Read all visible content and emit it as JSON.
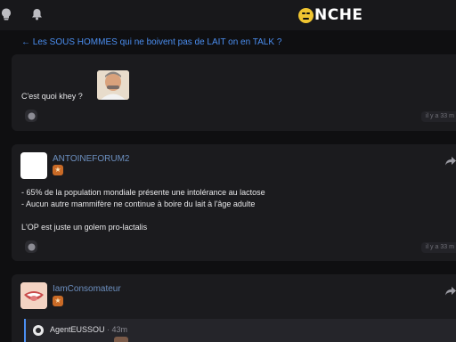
{
  "topbar": {
    "left_icons": [
      "lightbulb-icon",
      "bell-icon"
    ],
    "logo_text": "NCHE"
  },
  "breadcrumb": {
    "arrow": "←",
    "title": "Les SOUS HOMMES qui ne boivent pas de LAIT on en TALK ?"
  },
  "posts": [
    {
      "text": "C'est quoi khey ?",
      "time": "il y a 33 m"
    },
    {
      "author": "ANTOINEFORUM2",
      "lines": [
        "- 65% de la population mondiale présente une intolérance au lactose",
        "- Aucun autre mammifère ne continue à boire du lait à l'âge adulte",
        "L'OP est juste un golem pro-lactalis"
      ],
      "time": "il y a 33 m"
    },
    {
      "author": "IamConsomateur",
      "quote": {
        "author": "AgentEUSSOU",
        "time": "· 43m"
      }
    }
  ],
  "colors": {
    "background": "#0f0f11",
    "card": "#1b1b1e",
    "link": "#4b8ef0",
    "author": "#6c8fbf",
    "badge": "#c96a26",
    "logo_face": "#f0c531"
  }
}
